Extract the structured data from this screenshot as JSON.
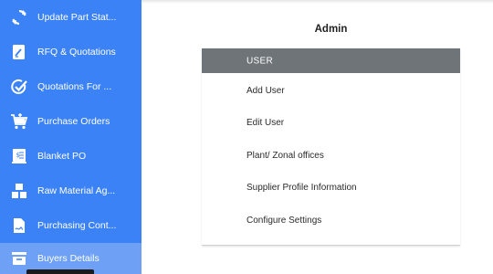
{
  "sidebar": {
    "items": [
      {
        "label": "Update Part Stat...",
        "icon": "refresh-icon"
      },
      {
        "label": "RFQ & Quotations",
        "icon": "edit-document-icon"
      },
      {
        "label": "Quotations For ...",
        "icon": "check-circle-icon"
      },
      {
        "label": "Purchase Orders",
        "icon": "cart-icon"
      },
      {
        "label": "Blanket PO",
        "icon": "receipt-icon"
      },
      {
        "label": "Raw Material Ag...",
        "icon": "boxes-icon"
      },
      {
        "label": "Purchasing Cont...",
        "icon": "contract-icon"
      },
      {
        "label": "Buyers Details",
        "icon": "buyer-icon"
      }
    ],
    "active_index": 7
  },
  "main": {
    "title": "Admin",
    "card": {
      "header": "USER",
      "links": [
        "Add User",
        "Edit User",
        "Plant/ Zonal offices",
        "Supplier Profile Information",
        "Configure Settings"
      ]
    }
  },
  "colors": {
    "sidebar_bg": "#3b82f6",
    "sidebar_active": "#6ea1f6",
    "card_header_bg": "#6f7478",
    "text": "#2a2a2a"
  }
}
